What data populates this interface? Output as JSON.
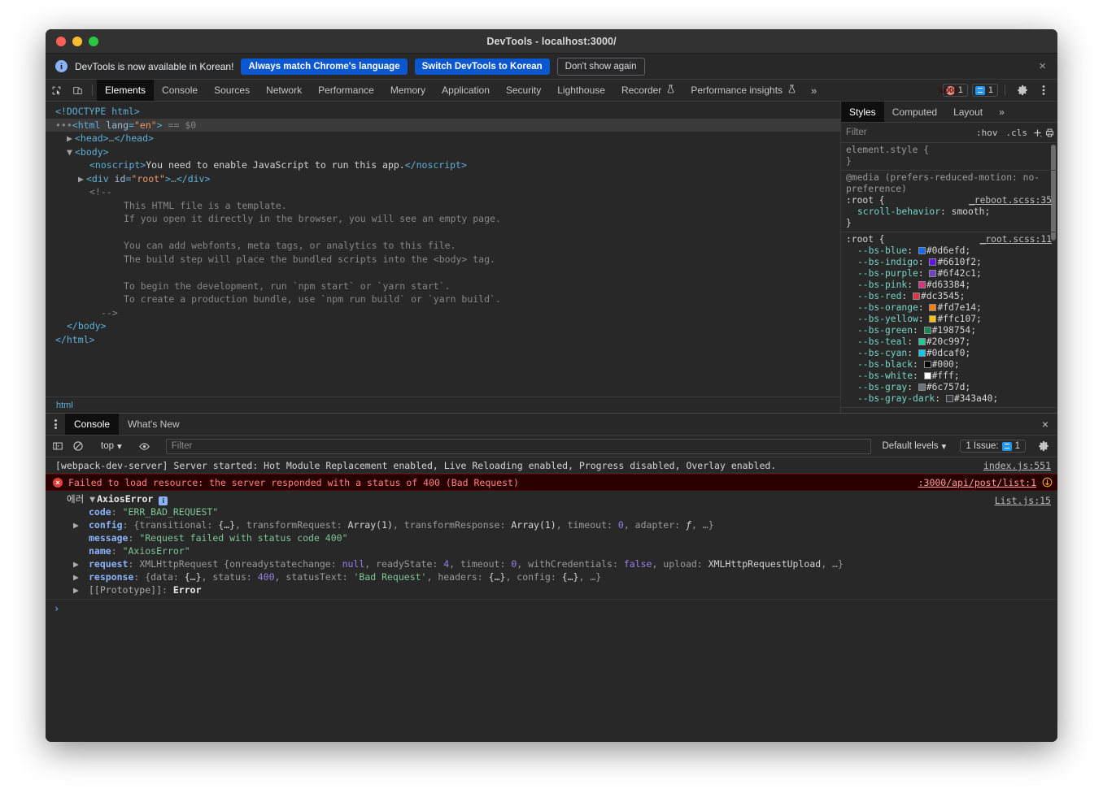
{
  "window": {
    "title": "DevTools - localhost:3000/",
    "traffic_lights": [
      "close-red",
      "minimize-amber",
      "maximize-green"
    ]
  },
  "notice": {
    "icon": "info-icon",
    "text": "DevTools is now available in Korean!",
    "primary_button": "Always match Chrome's language",
    "secondary_button": "Switch DevTools to Korean",
    "dismiss_button": "Don't show again",
    "close_icon": "×"
  },
  "tabstrip": {
    "inspect_icon": "inspect-element-icon",
    "device_icon": "device-toolbar-icon",
    "tabs": [
      {
        "label": "Elements",
        "active": true,
        "flask": false
      },
      {
        "label": "Console",
        "active": false,
        "flask": false
      },
      {
        "label": "Sources",
        "active": false,
        "flask": false
      },
      {
        "label": "Network",
        "active": false,
        "flask": false
      },
      {
        "label": "Performance",
        "active": false,
        "flask": false
      },
      {
        "label": "Memory",
        "active": false,
        "flask": false
      },
      {
        "label": "Application",
        "active": false,
        "flask": false
      },
      {
        "label": "Security",
        "active": false,
        "flask": false
      },
      {
        "label": "Lighthouse",
        "active": false,
        "flask": false
      },
      {
        "label": "Recorder",
        "active": false,
        "flask": true
      },
      {
        "label": "Performance insights",
        "active": false,
        "flask": true
      }
    ],
    "overflow_label": "»",
    "error_count": "1",
    "issue_count": "1",
    "settings_icon": "gear-icon",
    "menu_icon": "kebab-menu-icon"
  },
  "dom": {
    "lines": [
      {
        "indent": 0,
        "arrow": "",
        "html": "<span class=\"tk-tag\">&lt;!DOCTYPE html&gt;</span>",
        "selected": false
      },
      {
        "indent": 0,
        "arrow": "",
        "html": "<span class=\"dots\">•••</span><span class=\"tk-tag\">&lt;html </span><span class=\"tk-attr\">lang</span><span class=\"tk-tag\">=</span><span class=\"tk-val\">\"en\"</span><span class=\"tk-tag\">&gt;</span> <span class=\"tk-sel\">== $0</span>",
        "selected": true
      },
      {
        "indent": 1,
        "arrow": "▶",
        "html": "<span class=\"tk-tag\">&lt;head&gt;</span><span class=\"dots\">…</span><span class=\"tk-tag\">&lt;/head&gt;</span>",
        "selected": false
      },
      {
        "indent": 1,
        "arrow": "▼",
        "html": "<span class=\"tk-tag\">&lt;body&gt;</span>",
        "selected": false
      },
      {
        "indent": 3,
        "arrow": "",
        "html": "<span class=\"tk-tag\">&lt;noscript&gt;</span><span class=\"tk-text\">You need to enable JavaScript to run this app.</span><span class=\"tk-tag\">&lt;/noscript&gt;</span>",
        "selected": false
      },
      {
        "indent": 2,
        "arrow": "▶",
        "html": "<span class=\"tk-tag\">&lt;div </span><span class=\"tk-attr\">id</span><span class=\"tk-tag\">=</span><span class=\"tk-val\">\"root\"</span><span class=\"tk-tag\">&gt;</span><span class=\"dots\">…</span><span class=\"tk-tag\">&lt;/div&gt;</span>",
        "selected": false
      },
      {
        "indent": 3,
        "arrow": "",
        "html": "<span class=\"tk-comment\">&lt;!--</span>",
        "selected": false
      },
      {
        "indent": 6,
        "arrow": "",
        "html": "<span class=\"tk-comment\">This HTML file is a template.</span>",
        "selected": false
      },
      {
        "indent": 6,
        "arrow": "",
        "html": "<span class=\"tk-comment\">If you open it directly in the browser, you will see an empty page.</span>",
        "selected": false
      },
      {
        "indent": 0,
        "arrow": "",
        "html": "&nbsp;",
        "selected": false
      },
      {
        "indent": 6,
        "arrow": "",
        "html": "<span class=\"tk-comment\">You can add webfonts, meta tags, or analytics to this file.</span>",
        "selected": false
      },
      {
        "indent": 6,
        "arrow": "",
        "html": "<span class=\"tk-comment\">The build step will place the bundled scripts into the &lt;body&gt; tag.</span>",
        "selected": false
      },
      {
        "indent": 0,
        "arrow": "",
        "html": "&nbsp;",
        "selected": false
      },
      {
        "indent": 6,
        "arrow": "",
        "html": "<span class=\"tk-comment\">To begin the development, run `npm start` or `yarn start`.</span>",
        "selected": false
      },
      {
        "indent": 6,
        "arrow": "",
        "html": "<span class=\"tk-comment\">To create a production bundle, use `npm run build` or `yarn build`.</span>",
        "selected": false
      },
      {
        "indent": 4,
        "arrow": "",
        "html": "<span class=\"tk-comment\">--&gt;</span>",
        "selected": false
      },
      {
        "indent": 1,
        "arrow": "",
        "html": "<span class=\"tk-tag\">&lt;/body&gt;</span>",
        "selected": false
      },
      {
        "indent": 0,
        "arrow": "",
        "html": "<span class=\"tk-tag\">&lt;/html&gt;</span>",
        "selected": false
      }
    ],
    "breadcrumb": [
      "html"
    ]
  },
  "styles": {
    "tabs": [
      {
        "label": "Styles",
        "active": true
      },
      {
        "label": "Computed",
        "active": false
      },
      {
        "label": "Layout",
        "active": false
      }
    ],
    "overflow_label": "»",
    "filter_placeholder": "Filter",
    "filter_value": "",
    "hov_label": ":hov",
    "cls_label": ".cls",
    "new_rule_icon": "plus-icon",
    "class_toggle_icon": "print-style-icon",
    "sidebar_toggle_icon": "collapse-sidebar-icon",
    "rules": [
      {
        "selector": "element.style {",
        "close": "}",
        "source": "",
        "media": "",
        "props": []
      },
      {
        "selector": ":root {",
        "close": "}",
        "source": "_reboot.scss:35",
        "media": "@media (prefers-reduced-motion: no-preference)",
        "props": [
          {
            "name": "scroll-behavior",
            "value": "smooth",
            "swatch": ""
          }
        ]
      },
      {
        "selector": ":root {",
        "close": "",
        "source": "_root.scss:11",
        "media": "",
        "props": [
          {
            "name": "--bs-blue",
            "value": "#0d6efd",
            "swatch": "#0d6efd"
          },
          {
            "name": "--bs-indigo",
            "value": "#6610f2",
            "swatch": "#6610f2"
          },
          {
            "name": "--bs-purple",
            "value": "#6f42c1",
            "swatch": "#6f42c1"
          },
          {
            "name": "--bs-pink",
            "value": "#d63384",
            "swatch": "#d63384"
          },
          {
            "name": "--bs-red",
            "value": "#dc3545",
            "swatch": "#dc3545"
          },
          {
            "name": "--bs-orange",
            "value": "#fd7e14",
            "swatch": "#fd7e14"
          },
          {
            "name": "--bs-yellow",
            "value": "#ffc107",
            "swatch": "#ffc107"
          },
          {
            "name": "--bs-green",
            "value": "#198754",
            "swatch": "#198754"
          },
          {
            "name": "--bs-teal",
            "value": "#20c997",
            "swatch": "#20c997"
          },
          {
            "name": "--bs-cyan",
            "value": "#0dcaf0",
            "swatch": "#0dcaf0"
          },
          {
            "name": "--bs-black",
            "value": "#000",
            "swatch": "#000000"
          },
          {
            "name": "--bs-white",
            "value": "#fff",
            "swatch": "#ffffff"
          },
          {
            "name": "--bs-gray",
            "value": "#6c757d",
            "swatch": "#6c757d"
          },
          {
            "name": "--bs-gray-dark",
            "value": "#343a40",
            "swatch": "#343a40"
          }
        ]
      }
    ]
  },
  "drawer": {
    "kebab_icon": "more-tools-icon",
    "tabs": [
      {
        "label": "Console",
        "active": true
      },
      {
        "label": "What's New",
        "active": false
      }
    ],
    "close_icon": "×",
    "toolbar": {
      "sidebar_icon": "console-sidebar-icon",
      "clear_icon": "clear-console-icon",
      "context": "top",
      "context_caret": "▾",
      "eye_icon": "live-expression-icon",
      "filter_placeholder": "Filter",
      "filter_value": "",
      "levels_label": "Default levels",
      "levels_caret": "▾",
      "issues_label": "1 Issue:",
      "issues_count": "1",
      "settings_icon": "gear-icon"
    },
    "messages": [
      {
        "type": "info",
        "text": "[webpack-dev-server] Server started: Hot Module Replacement enabled, Live Reloading enabled, Progress disabled, Overlay enabled.",
        "link": "index.js:551"
      },
      {
        "type": "error",
        "text": "Failed to load resource: the server responded with a status of 400 (Bad Request)",
        "link": ":3000/api/post/list:1",
        "net_icon": "network-request-icon"
      }
    ],
    "error_object": {
      "label_prefix": "에러",
      "title": "AxiosError",
      "info_badge": "i",
      "link": "List.js:15",
      "properties": [
        {
          "expandable": false,
          "key": "code",
          "sep": ": ",
          "value_html": "<span class=\"k-str\">\"ERR_BAD_REQUEST\"</span>"
        },
        {
          "expandable": true,
          "key": "config",
          "sep": ": ",
          "value_html": "<span class=\"k-dim\">{transitional: </span><span class=\"k-plain\">{…}</span><span class=\"k-dim\">, transformRequest: </span><span class=\"k-plain\">Array(1)</span><span class=\"k-dim\">, transformResponse: </span><span class=\"k-plain\">Array(1)</span><span class=\"k-dim\">, timeout: </span><span class=\"k-num\">0</span><span class=\"k-dim\">, adapter: </span><span class=\"k-plain\"><i>ƒ</i></span><span class=\"k-dim\">, …}</span>"
        },
        {
          "expandable": false,
          "key": "message",
          "sep": ": ",
          "value_html": "<span class=\"k-str\">\"Request failed with status code 400\"</span>"
        },
        {
          "expandable": false,
          "key": "name",
          "sep": ": ",
          "value_html": "<span class=\"k-str\">\"AxiosError\"</span>"
        },
        {
          "expandable": true,
          "key": "request",
          "sep": ": ",
          "value_html": "<span class=\"k-dim\">XMLHttpRequest {onreadystatechange: </span><span class=\"k-null\">null</span><span class=\"k-dim\">, readyState: </span><span class=\"k-num\">4</span><span class=\"k-dim\">, timeout: </span><span class=\"k-num\">0</span><span class=\"k-dim\">, withCredentials: </span><span class=\"k-num\">false</span><span class=\"k-dim\">, upload: </span><span class=\"k-plain\">XMLHttpRequestUpload</span><span class=\"k-dim\">, …}</span>"
        },
        {
          "expandable": true,
          "key": "response",
          "sep": ": ",
          "value_html": "<span class=\"k-dim\">{data: </span><span class=\"k-plain\">{…}</span><span class=\"k-dim\">, status: </span><span class=\"k-num\">400</span><span class=\"k-dim\">, statusText: </span><span class=\"k-str\">'Bad Request'</span><span class=\"k-dim\">, headers: </span><span class=\"k-plain\">{…}</span><span class=\"k-dim\">, config: </span><span class=\"k-plain\">{…}</span><span class=\"k-dim\">, …}</span>"
        },
        {
          "expandable": true,
          "key": "[[Prototype]]",
          "sep": ": ",
          "key_dim": true,
          "value_html": "<span class=\"k-name\">Error</span>"
        }
      ]
    },
    "prompt": "›"
  },
  "colors": {
    "accent_blue": "#0b57d0",
    "error_red": "#e23f3f",
    "link_blue": "#8ab4f8",
    "panel_bg": "#282828",
    "active_tab_bg": "#0f0f0f"
  }
}
